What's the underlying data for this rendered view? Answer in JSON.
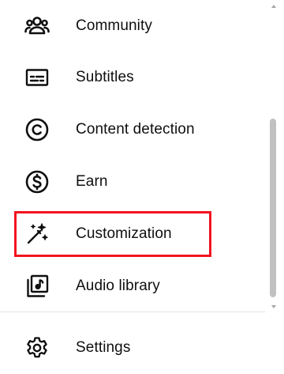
{
  "nav": {
    "items": [
      {
        "label": "Community",
        "icon": "community-icon"
      },
      {
        "label": "Subtitles",
        "icon": "subtitles-icon"
      },
      {
        "label": "Content detection",
        "icon": "copyright-icon"
      },
      {
        "label": "Earn",
        "icon": "dollar-icon"
      },
      {
        "label": "Customization",
        "icon": "magic-wand-icon",
        "highlighted": true
      },
      {
        "label": "Audio library",
        "icon": "audio-library-icon"
      }
    ],
    "settings": {
      "label": "Settings",
      "icon": "gear-icon"
    }
  },
  "colors": {
    "text": "#0f0f0f",
    "highlight": "#f2141e",
    "divider": "#e5e5e5",
    "scrollbar_thumb": "#c1c1c1"
  }
}
